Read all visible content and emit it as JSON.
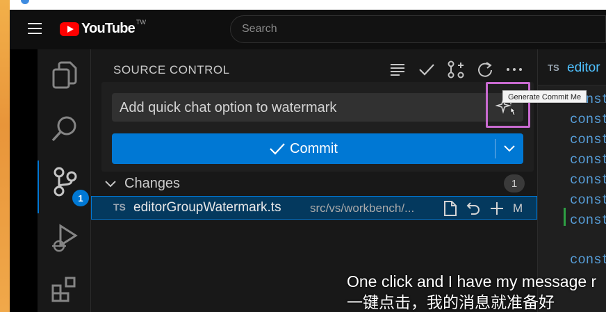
{
  "youtube": {
    "logo_text": "YouTube",
    "logo_suffix": "TW",
    "search_placeholder": "Search"
  },
  "vscode": {
    "activity_bar": {
      "items": [
        "explorer",
        "search",
        "source-control",
        "run-and-debug",
        "extensions"
      ],
      "source_control_badge": "1"
    },
    "source_control": {
      "title": "SOURCE CONTROL",
      "message_value": "Add quick chat option to watermark",
      "sparkle_tooltip": "Generate Commit Me",
      "commit_label": "Commit",
      "changes_label": "Changes",
      "changes_count": "1",
      "files": [
        {
          "lang": "TS",
          "name": "editorGroupWatermark.ts",
          "path": "src/vs/workbench/...",
          "status": "M"
        }
      ]
    },
    "editor": {
      "tab_lang": "TS",
      "tab_name": "editor",
      "code_keyword": "const"
    }
  },
  "subtitles": {
    "line_en": "One click and I have my message r",
    "line_zh": "一键点击，我的消息就准备好"
  },
  "colors": {
    "accent": "#0078d4",
    "highlight": "#c86ad0",
    "youtube_red": "#ff0000"
  }
}
